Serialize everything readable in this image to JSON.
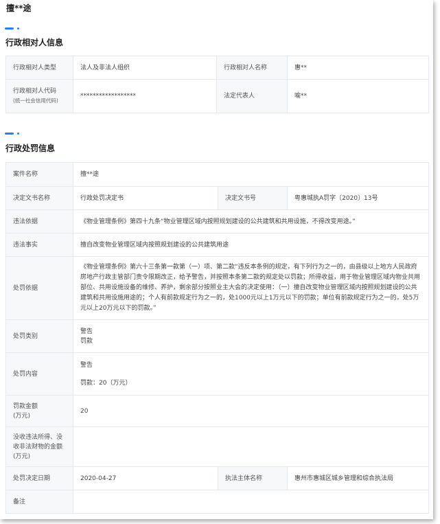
{
  "page": {
    "title": "擅**途"
  },
  "party_section": {
    "title": "行政相对人信息",
    "rows": [
      {
        "label1": "行政相对人类型",
        "value1": "法人及非法人组织",
        "label2": "行政相对人名称",
        "value2": "惠**"
      },
      {
        "label1": "行政相对人代码",
        "label1_sub": "(统一社会信用代码)",
        "value1": "******************",
        "label2": "法定代表人",
        "value2": "喻**"
      }
    ]
  },
  "penalty_section": {
    "title": "行政处罚信息",
    "case_name": {
      "label": "案件名称",
      "value": "擅**途"
    },
    "decision_doc": {
      "label": "决定文书名称",
      "value": "行政处罚决定书",
      "label2": "决定文书号",
      "value2": "粤惠城执A罚字〔2020〕13号"
    },
    "violation_basis": {
      "label": "违法依据",
      "value": "《物业管理条例》第四十九条“物业管理区域内按照规划建设的公共建筑和共用设施，不得改变用途。”"
    },
    "violation_fact": {
      "label": "违法事实",
      "value": "擅自改变物业管理区域内按照规划建设的公共建筑用途"
    },
    "penalty_basis": {
      "label": "处罚依据",
      "value": "《物业管理条例》第六十三条第一款第（一）项、第二款“违反本条例的规定，有下列行为之一的，由县级以上地方人民政府房地产行政主管部门责令限期改正，给予警告，并按照本条第二款的规定处以罚款；所得收益，用于物业管理区域内物业共用部位、共用设施设备的维修、养护，剩余部分按照业主大会的决定使用：（一）擅自改变物业管理区域内按照规划建设的公共建筑和共用设施用途的；个人有前款规定行为之一的，处1000元以上1万元以下的罚款；单位有前款规定行为之一的，处5万元以上20万元以下的罚款。”"
    },
    "penalty_type": {
      "label": "处罚类别",
      "values": [
        "警告",
        "罚款"
      ]
    },
    "penalty_content": {
      "label": "处罚内容",
      "line1": "警告",
      "line2": "罚款：20（万元）"
    },
    "fine_amount": {
      "label": "罚款金额\n(万元)",
      "value": "20"
    },
    "confiscation": {
      "label": "没收违法所得、没收非法财物的金额(万元)",
      "value": ""
    },
    "decision_date": {
      "label": "处罚决定日期",
      "value": "2020-04-27",
      "label2": "执法主体名称",
      "value2": "惠州市惠城区城乡管理和综合执法局"
    },
    "remarks": {
      "label": "备注",
      "value": ""
    }
  }
}
